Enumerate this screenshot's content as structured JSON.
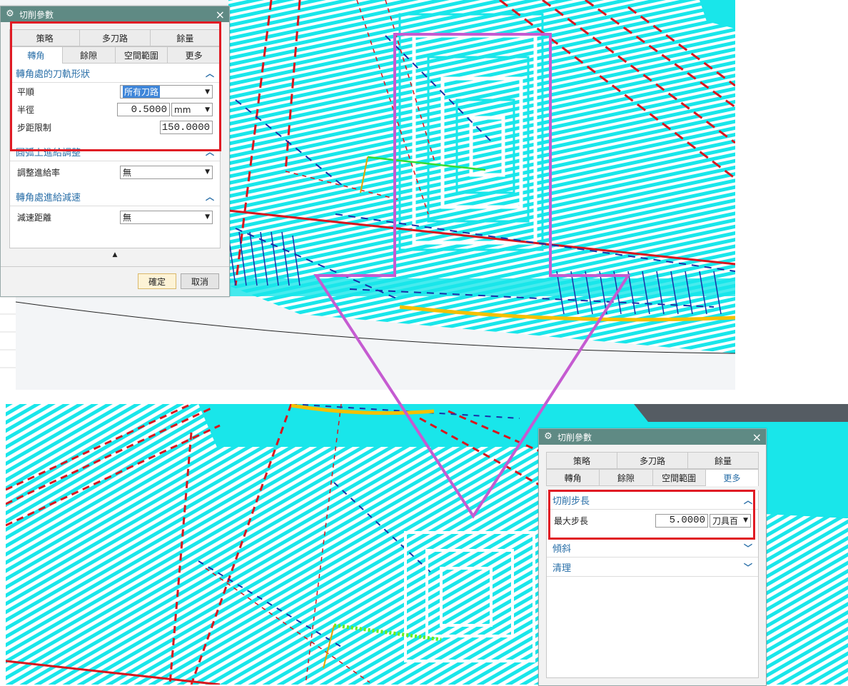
{
  "colors": {
    "titlebar": "#5f8a84",
    "accent": "#2a6fa8",
    "highlight_box": "#e01b24",
    "arrow": "#c55bd1",
    "toolpath_cyan": "#19e6ea",
    "toolpath_red": "#d9161e",
    "toolpath_blue": "#1b2fa6"
  },
  "dialog_top": {
    "title": "切削參數",
    "icon": "gear-icon",
    "close": "×",
    "tabs_row1": [
      "策略",
      "多刀路",
      "餘量"
    ],
    "tabs_row2": [
      "轉角",
      "餘隙",
      "空間範圍",
      "更多"
    ],
    "active_tab": "轉角",
    "section1": {
      "title": "轉角處的刀軌形狀",
      "rows": [
        {
          "label": "平順",
          "value": "所有刀路"
        },
        {
          "label": "半徑",
          "value": "0.5000",
          "unit": "mm"
        },
        {
          "label": "步距限制",
          "value": "150.0000"
        }
      ]
    },
    "section2": {
      "title": "圓弧上進給調整",
      "rows": [
        {
          "label": "調整進給率",
          "value": "無"
        }
      ]
    },
    "section3": {
      "title": "轉角處進給減速",
      "rows": [
        {
          "label": "減速距離",
          "value": "無"
        }
      ]
    },
    "ok": "確定",
    "cancel": "取消"
  },
  "dialog_bottom": {
    "title": "切削參數",
    "icon": "gear-icon",
    "close": "×",
    "tabs_row1": [
      "策略",
      "多刀路",
      "餘量"
    ],
    "tabs_row2": [
      "轉角",
      "餘隙",
      "空間範圍",
      "更多"
    ],
    "active_tab": "更多",
    "section1": {
      "title": "切削步長",
      "rows": [
        {
          "label": "最大步長",
          "value": "5.0000",
          "unit": "刀具百"
        }
      ]
    },
    "section2": {
      "title": "傾斜"
    },
    "section3": {
      "title": "清理"
    }
  }
}
